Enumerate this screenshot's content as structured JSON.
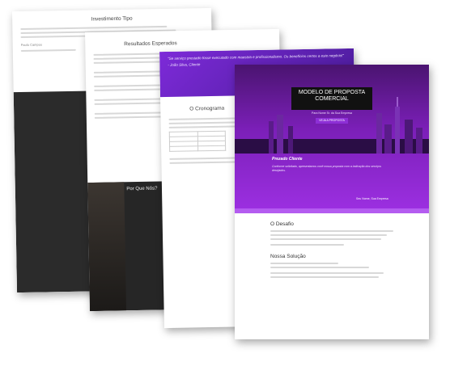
{
  "pages": {
    "p1": {
      "heading": "Investimento   Tipo",
      "author": "Paulo Campos"
    },
    "p2": {
      "heading": "Resultados   Esperados",
      "section": "Por Que Nós?"
    },
    "p3": {
      "quote": "\"Se serviço prestado fosse executado com maestria e profissionalismo. Os benefícios certos a este negócio!\"",
      "quote_author": "- João Silva, Cliente",
      "heading": "O Cronograma"
    },
    "p4": {
      "title": "MODELO DE PROPOSTA COMERCIAL",
      "subtitle": "Para Nome Sr. da Sua Empresa",
      "cta": "VEJA A PROPOSTA",
      "greeting": "Prezado  Cliente",
      "intro": "Conforme solicitado, apresentamos você nossa proposta com a indicação dos serviços desejados.",
      "sign": "Seu Nome, Sua Empresa",
      "sections": [
        "O Desafio",
        "Nossa  Solução"
      ]
    }
  },
  "colors": {
    "purple_dark": "#4a1470",
    "purple": "#7b1fb8",
    "accent": "#b45cf0",
    "dark_bg": "#262626"
  }
}
